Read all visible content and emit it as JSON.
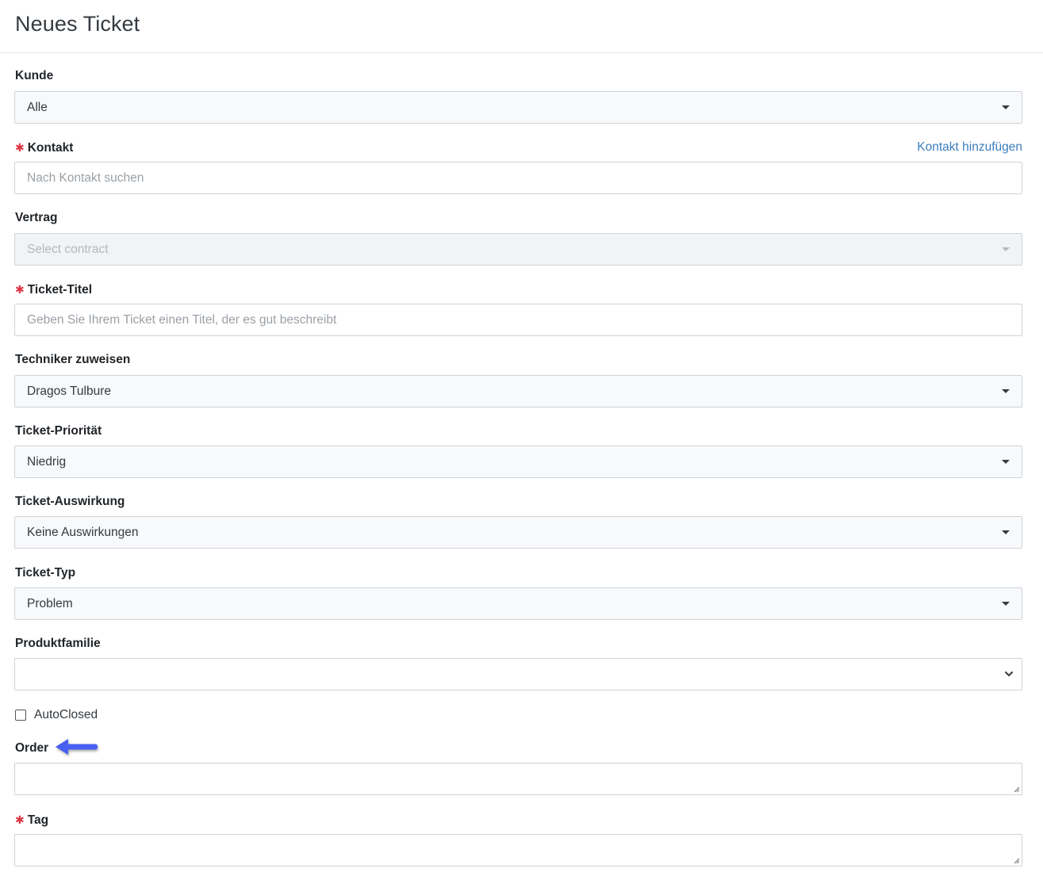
{
  "header": {
    "title": "Neues Ticket"
  },
  "form": {
    "kunde": {
      "label": "Kunde",
      "value": "Alle"
    },
    "kontakt": {
      "label": "Kontakt",
      "required_mark": "✱",
      "placeholder": "Nach Kontakt suchen",
      "add_link": "Kontakt hinzufügen"
    },
    "vertrag": {
      "label": "Vertrag",
      "placeholder": "Select contract"
    },
    "ticket_titel": {
      "label": "Ticket-Titel",
      "required_mark": "✱",
      "placeholder": "Geben Sie Ihrem Ticket einen Titel, der es gut beschreibt"
    },
    "techniker": {
      "label": "Techniker zuweisen",
      "value": "Dragos Tulbure"
    },
    "prioritaet": {
      "label": "Ticket-Priorität",
      "value": "Niedrig"
    },
    "auswirkung": {
      "label": "Ticket-Auswirkung",
      "value": "Keine Auswirkungen"
    },
    "typ": {
      "label": "Ticket-Typ",
      "value": "Problem"
    },
    "produktfamilie": {
      "label": "Produktfamilie",
      "value": ""
    },
    "autoclosed": {
      "label": "AutoClosed",
      "checked": false
    },
    "order": {
      "label": "Order",
      "value": ""
    },
    "tag": {
      "label": "Tag",
      "required_mark": "✱",
      "value": ""
    }
  },
  "colors": {
    "required": "#dc3545",
    "link": "#3d7ebf",
    "annotation_arrow": "#4a5ef0"
  },
  "icons": {
    "dropdown": "caret-down-icon",
    "native_select": "chevron-down-icon",
    "annotation": "arrow-left-icon",
    "resize": "resize-handle-icon"
  }
}
